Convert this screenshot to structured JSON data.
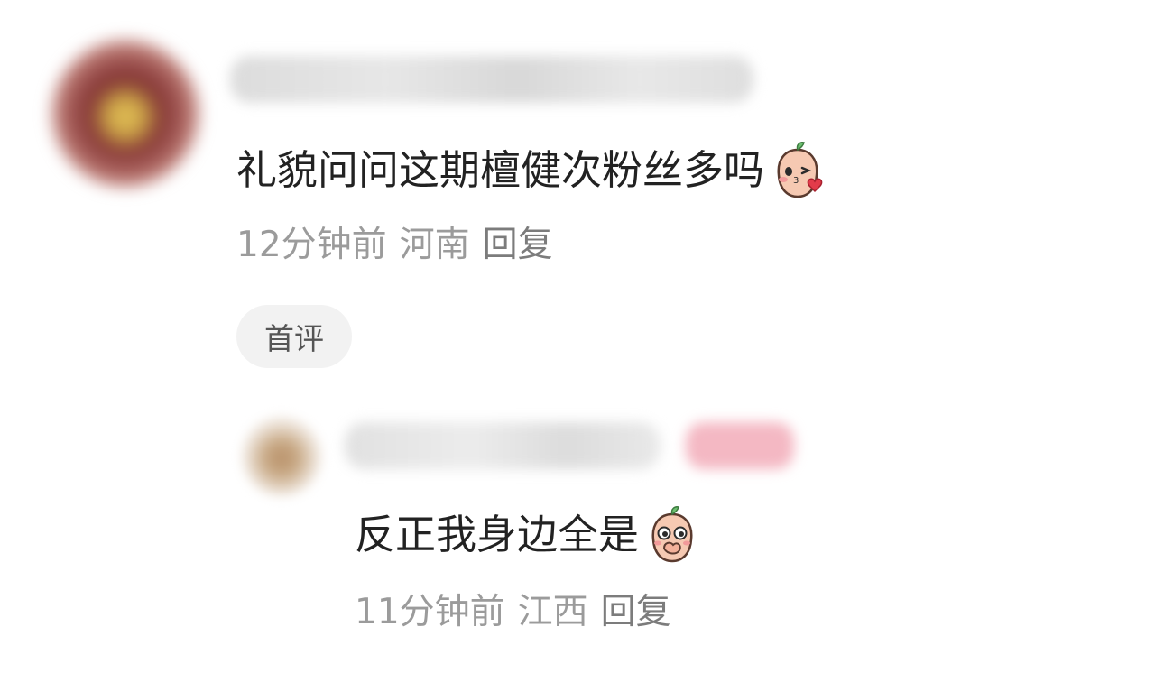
{
  "comments": [
    {
      "text": "礼貌问问这期檀健次粉丝多吗",
      "emoji": "kiss-heart-peach-icon",
      "time": "12分钟前",
      "location": "河南",
      "reply_label": "回复",
      "tag": "首评"
    }
  ],
  "reply": {
    "text": "反正我身边全是",
    "emoji": "covering-mouth-peach-icon",
    "time": "11分钟前",
    "location": "江西",
    "reply_label": "回复"
  },
  "colors": {
    "text": "#222222",
    "meta": "#9b9b9b",
    "tag_bg": "#f2f2f2",
    "emoji_face": "#f3c0a8"
  }
}
